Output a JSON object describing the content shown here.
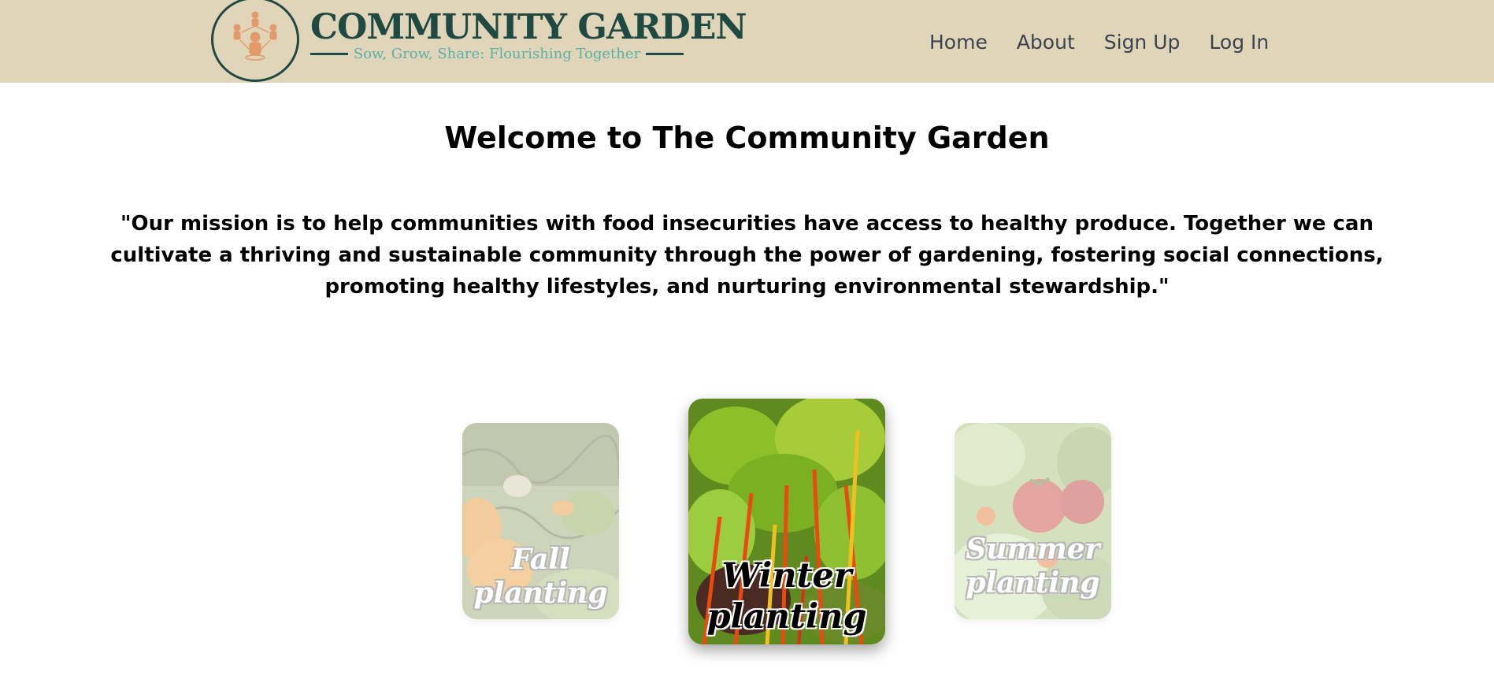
{
  "header": {
    "brand_title": "COMMUNITY GARDEN",
    "tagline": "Sow, Grow, Share: Flourishing Together",
    "logo_icon": "community-people-icon",
    "colors": {
      "background": "#e0d5b8",
      "brand": "#1f4a44",
      "tagline": "#5bb0a8",
      "logo_people": "#e39a6a"
    }
  },
  "nav": {
    "items": [
      {
        "label": "Home"
      },
      {
        "label": "About"
      },
      {
        "label": "Sign Up"
      },
      {
        "label": "Log In"
      }
    ]
  },
  "main": {
    "welcome_title": "Welcome to The Community Garden",
    "mission": "\"Our mission is to help communities with food insecurities have access to healthy produce. Together we can cultivate a thriving and sustainable community through the power of gardening, fostering social connections, promoting healthy lifestyles, and nurturing environmental stewardship.\""
  },
  "carousel": {
    "cards": [
      {
        "line1": "Fall",
        "line2": "planting",
        "image": "pumpkins",
        "active": false
      },
      {
        "line1": "Winter",
        "line2": "planting",
        "image": "chard",
        "active": true
      },
      {
        "line1": "Summer",
        "line2": "planting",
        "image": "tomatoes",
        "active": false
      }
    ]
  }
}
